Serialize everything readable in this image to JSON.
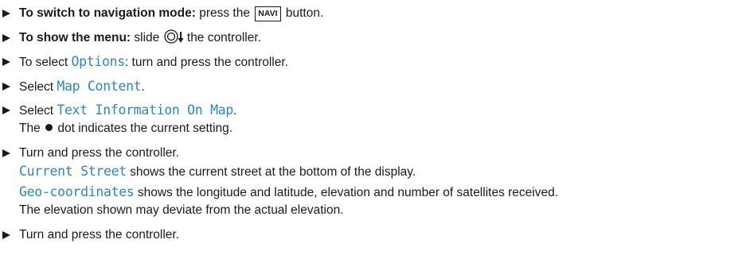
{
  "steps": [
    {
      "bold": "To switch to navigation mode:",
      "pre": " press the",
      "key": "NAVI",
      "post": " button."
    },
    {
      "bold": "To show the menu:",
      "pre": " slide",
      "post": " the controller."
    },
    {
      "pre": "To select ",
      "display": "Options",
      "post": ": turn and press the controller."
    },
    {
      "pre": "Select ",
      "display": "Map Content",
      "post": "."
    },
    {
      "pre": "Select ",
      "display": "Text Information On Map",
      "post": ".",
      "note_pre": "The",
      "note_post": "dot indicates the current setting."
    },
    {
      "pre": "Turn and press the controller.",
      "line2_display": "Current Street",
      "line2_text": " shows the current street at the bottom of the display.",
      "line3_display": "Geo-coordinates",
      "line3_text": " shows the longitude and latitude, elevation and number of satellites received.",
      "line4_text": "The elevation shown may deviate from the actual elevation."
    },
    {
      "pre": "Turn and press the controller."
    }
  ]
}
